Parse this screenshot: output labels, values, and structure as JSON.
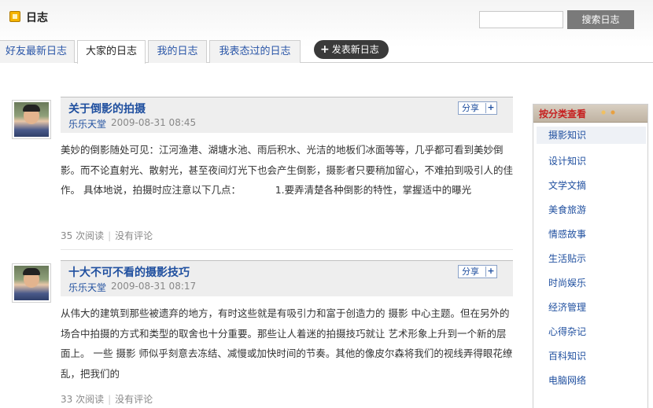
{
  "header": {
    "title": "日志",
    "search_button": "搜索日志",
    "search_value": "",
    "icon": "journal-icon"
  },
  "tabs": [
    {
      "label": "好友最新日志",
      "active": false
    },
    {
      "label": "大家的日志",
      "active": true
    },
    {
      "label": "我的日志",
      "active": false
    },
    {
      "label": "我表态过的日志",
      "active": false
    }
  ],
  "new_post_button": "发表新日志",
  "posts": [
    {
      "title": "关于倒影的拍摄",
      "author": "乐乐天堂",
      "date": "2009-08-31 08:45",
      "share_label": "分享",
      "excerpt": "美妙的倒影随处可见：江河渔港、湖塘水池、雨后积水、光洁的地板们冰面等等，几乎都可看到美妙倒影。而不论直射光、散射光，甚至夜间灯光下也会产生倒影，摄影者只要稍加留心，不难拍到吸引人的佳作。 具体地说，拍摄时应注意以下几点：　　　　1.要弄清楚各种倒影的特性，掌握适中的曝光",
      "reads": "35 次阅读",
      "comments": "没有评论"
    },
    {
      "title": "十大不可不看的摄影技巧",
      "author": "乐乐天堂",
      "date": "2009-08-31 08:17",
      "share_label": "分享",
      "excerpt": "从伟大的建筑到那些被遗弃的地方，有时这些就是有吸引力和富于创造力的 摄影 中心主题。但在另外的场合中拍摄的方式和类型的取舍也十分重要。那些让人着迷的拍摄技巧就让 艺术形象上升到一个新的层面上。 一些 摄影 师似乎刻意去冻结、减慢或加快时间的节奏。其他的像皮尔森将我们的视线弄得眼花缭乱，把我们的",
      "reads": "33 次阅读",
      "comments": "没有评论"
    }
  ],
  "categories": {
    "title": "按分类查看",
    "items": [
      "摄影知识",
      "设计知识",
      "文学文摘",
      "美食旅游",
      "情感故事",
      "生活贴示",
      "时尚娱乐",
      "经济管理",
      "心得杂记",
      "百科知识",
      "电脑网络"
    ]
  }
}
